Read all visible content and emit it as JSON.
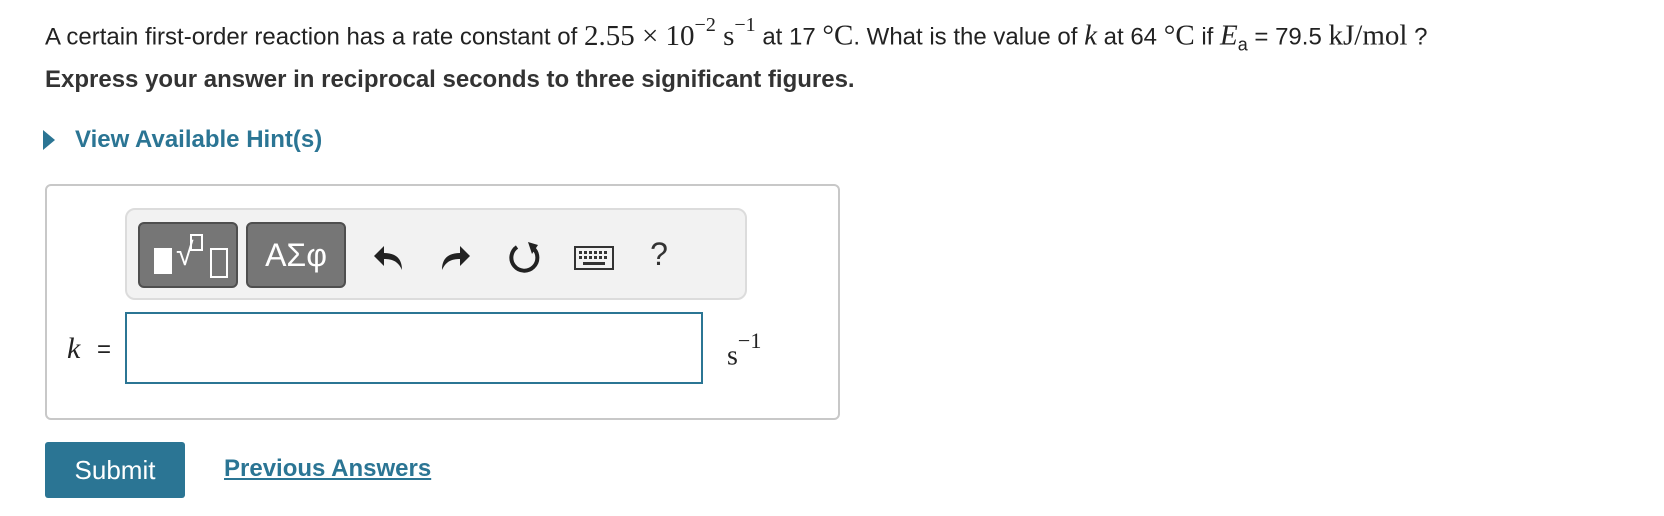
{
  "problem": {
    "t1": "A certain first-order reaction has a rate constant of ",
    "k1_mantissa": "2.55",
    "times": "×",
    "ten": "10",
    "exp1": "−2",
    "s": "s",
    "exp_s": "−1",
    "t2": " at 17 ",
    "deg": "°",
    "C": "C",
    "t3": ". What is the value of ",
    "k": "k",
    "t4": " at 64 ",
    "t5": " if ",
    "E": "E",
    "E_sub": "a",
    "t6": " = 79.5 ",
    "unit_kJ": "kJ",
    "slash": "/",
    "unit_mol": "mol",
    "t7": " ?"
  },
  "instruction": "Express your answer in reciprocal seconds to three significant figures.",
  "hint_label": "View Available Hint(s)",
  "toolbar": {
    "greek_label": "ΑΣφ",
    "help_label": "?",
    "icons": [
      "templates-icon",
      "greek-letters-icon",
      "undo-icon",
      "redo-icon",
      "reset-icon",
      "keyboard-icon",
      "help-icon"
    ]
  },
  "answer": {
    "variable": "k",
    "equals": "=",
    "value": "",
    "unit_base": "s",
    "unit_exp": "−1"
  },
  "buttons": {
    "submit": "Submit",
    "previous_answers": "Previous Answers"
  },
  "colors": {
    "accent": "#2b7594",
    "toolbar_button": "#767676"
  }
}
